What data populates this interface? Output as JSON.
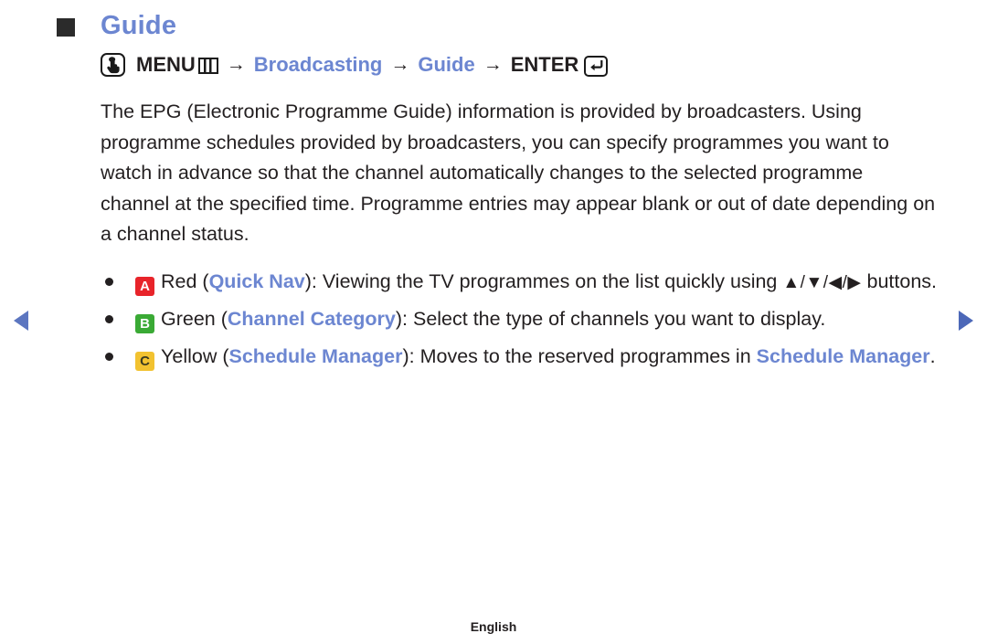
{
  "title": {
    "text": "Guide"
  },
  "nav": {
    "prev_label": "◀",
    "next_label": "▶"
  },
  "menu_path": {
    "touch_icon": "hand-press-icon",
    "menu_label": "MENU",
    "menu_icon": "menu-grid-icon",
    "arrow1": "→",
    "broadcasting_label": "Broadcasting",
    "arrow2": "→",
    "guide_label": "Guide",
    "arrow3": "→",
    "enter_label": "ENTER",
    "enter_icon": "enter-return-icon"
  },
  "body": {
    "paragraph": "The EPG (Electronic Programme Guide) information is provided by broadcasters. Using programme schedules provided by broadcasters, you can specify programmes you want to watch in advance so that the channel automatically changes to the selected programme channel at the specified time. Programme entries may appear blank or out of date depending on a channel status."
  },
  "bullets": [
    {
      "badge": "A",
      "badge_color": "#e8242a",
      "colour_name": "Red",
      "feature": "Quick Nav",
      "text_before": "Red (",
      "text_after_open": "): Viewing the TV programmes on the list quickly using ",
      "directions": "▲/▼/◀/▶",
      "text_end": " buttons."
    },
    {
      "badge": "B",
      "badge_color": "#3aaa35",
      "colour_name": "Green",
      "feature": "Channel Category",
      "text_before": "Green (",
      "text_after_open": "): Select the type of channels you want to display."
    },
    {
      "badge": "C",
      "badge_color": "#f2c230",
      "colour_name": "Yellow",
      "feature": "Schedule Manager",
      "text_before": "Yellow (",
      "text_after_open": "): Moves to the reserved programmes in ",
      "feature_tail": "Schedule Manager",
      "text_end": "."
    }
  ],
  "footer": {
    "language": "English"
  },
  "colors": {
    "accent_blue": "#6c86d1",
    "text": "#231f20",
    "square_bullet": "#2b2b2b"
  }
}
